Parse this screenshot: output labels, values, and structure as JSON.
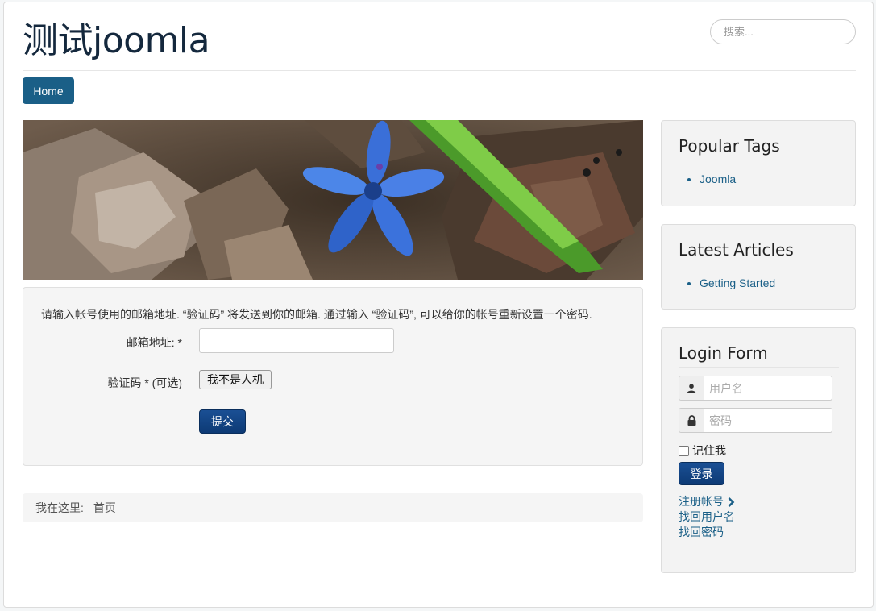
{
  "header": {
    "site_title": "测试joomla",
    "search_placeholder": "搜索..."
  },
  "nav": {
    "items": [
      {
        "label": "Home"
      }
    ]
  },
  "reset_form": {
    "intro": "请输入帐号使用的邮箱地址. “验证码” 将发送到你的邮箱. 通过输入 “验证码”, 可以给你的帐号重新设置一个密码.",
    "email_label": "邮箱地址: *",
    "email_value": "",
    "captcha_label": "验证码 * (可选)",
    "captcha_button": "我不是人机",
    "submit_label": "提交"
  },
  "breadcrumb": {
    "prefix": "我在这里:",
    "current": "首页"
  },
  "sidebar": {
    "popular_tags": {
      "title": "Popular Tags",
      "items": [
        "Joomla"
      ]
    },
    "latest_articles": {
      "title": "Latest Articles",
      "items": [
        "Getting Started"
      ]
    },
    "login_form": {
      "title": "Login Form",
      "username_placeholder": "用户名",
      "password_placeholder": "密码",
      "remember_label": "记住我",
      "remember_checked": false,
      "login_button": "登录",
      "links": [
        "注册帐号",
        "找回用户名",
        "找回密码"
      ]
    }
  },
  "colors": {
    "brand": "#1a5f87",
    "button_primary": "#1a4f94",
    "title": "#14283d"
  },
  "icons": {
    "register_arrow": "chevron-right-icon",
    "username": "user-icon",
    "password": "lock-icon"
  }
}
